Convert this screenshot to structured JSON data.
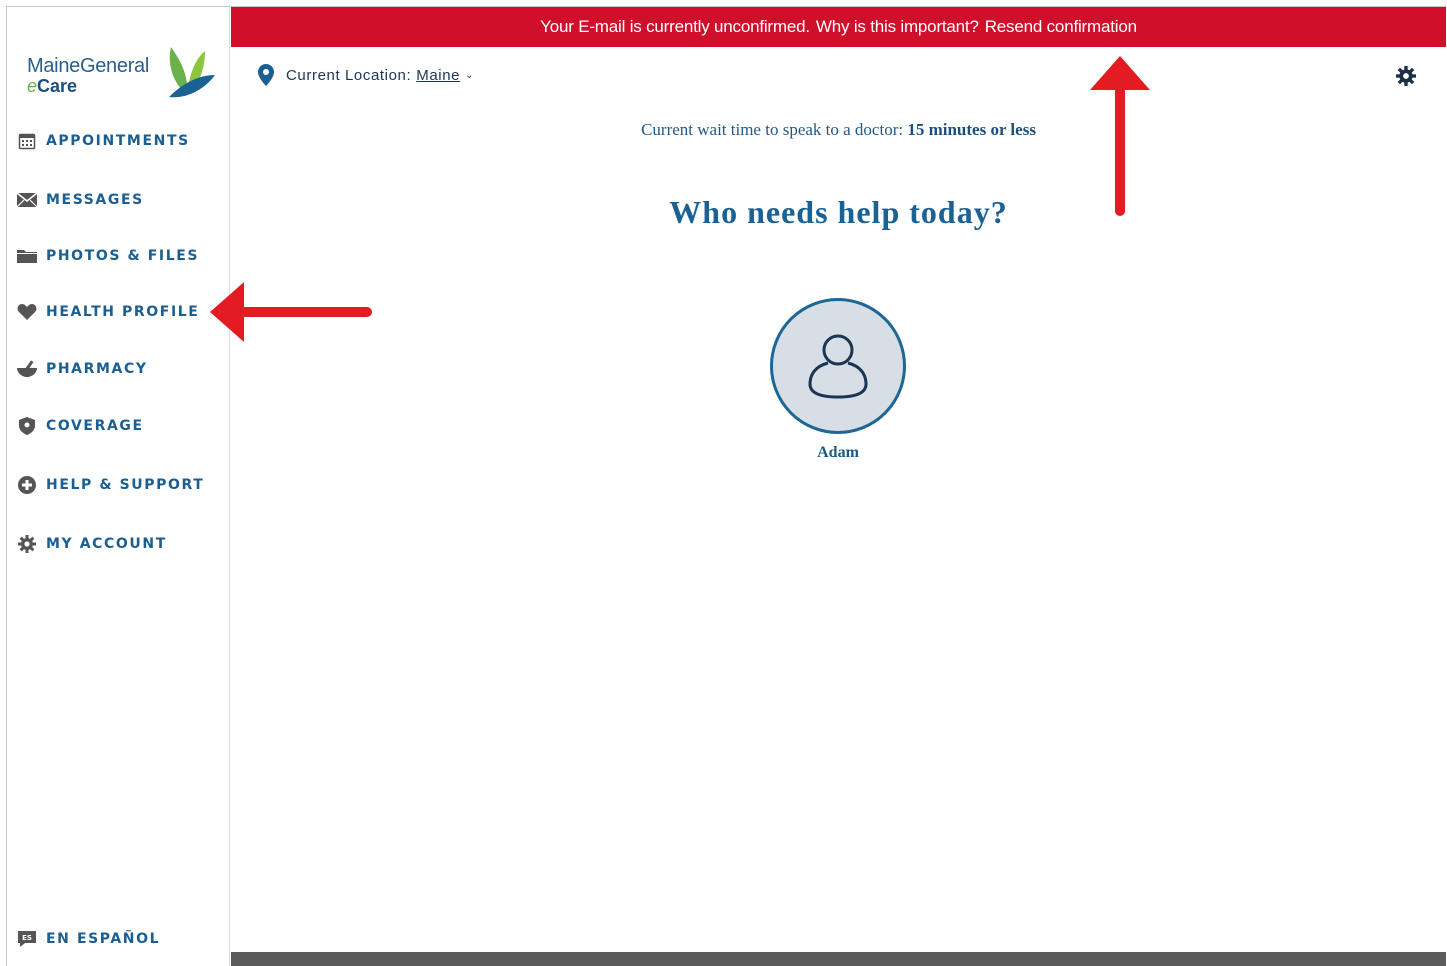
{
  "brand": {
    "line1": "MaineGeneral",
    "line2_prefix": "e",
    "line2_rest": "Care"
  },
  "banner": {
    "message": "Your E-mail is currently unconfirmed.",
    "why_link": "Why is this important?",
    "resend_link": "Resend confirmation",
    "color": "#d0102a"
  },
  "sidebar": {
    "items": [
      {
        "label": "APPOINTMENTS",
        "icon": "calendar-icon"
      },
      {
        "label": "MESSAGES",
        "icon": "envelope-icon"
      },
      {
        "label": "PHOTOS & FILES",
        "icon": "folder-icon"
      },
      {
        "label": "HEALTH PROFILE",
        "icon": "heart-icon"
      },
      {
        "label": "PHARMACY",
        "icon": "mortar-pestle-icon"
      },
      {
        "label": "COVERAGE",
        "icon": "shield-icon"
      },
      {
        "label": "HELP & SUPPORT",
        "icon": "plus-circle-icon"
      },
      {
        "label": "MY ACCOUNT",
        "icon": "gear-icon"
      }
    ],
    "language": {
      "label": "EN ESPAÑOL",
      "icon": "es-speech-bubble-icon"
    }
  },
  "header": {
    "location_label": "Current Location:",
    "location_value": "Maine"
  },
  "main": {
    "wait_prefix": "Current wait time to speak to a doctor:",
    "wait_value": "15 minutes or less",
    "headline": "Who needs help today?",
    "patients": [
      {
        "name": "Adam",
        "icon": "person-icon"
      }
    ]
  },
  "colors": {
    "accent": "#1b6294",
    "nav_text": "#1b5e92",
    "annotation_arrow": "#e31b23"
  }
}
